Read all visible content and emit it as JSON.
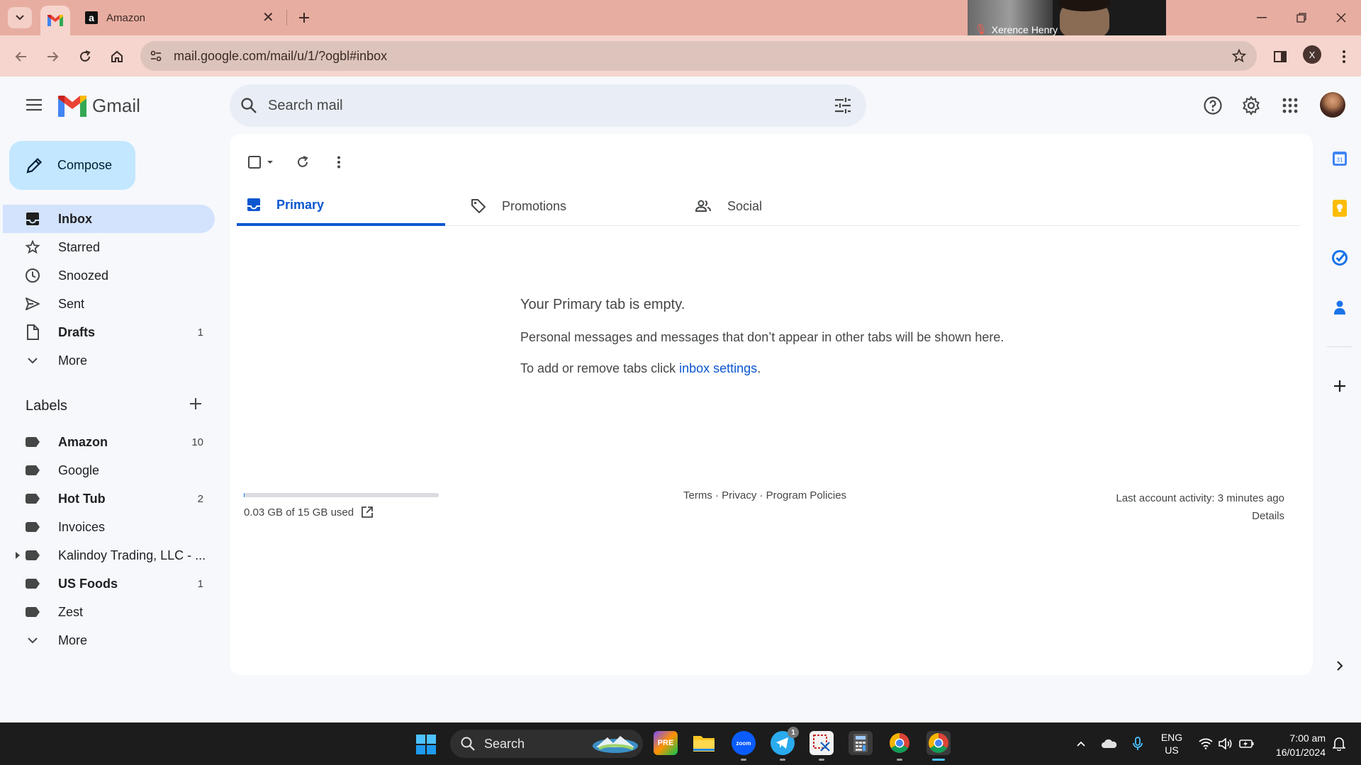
{
  "browser": {
    "tabs": [
      {
        "label": ""
      },
      {
        "label": "Amazon"
      }
    ],
    "url": "mail.google.com/mail/u/1/?ogbl#inbox",
    "profile_initial": "X",
    "call_overlay_name": "Xerence Henry"
  },
  "gmail": {
    "logo_text": "Gmail",
    "search_placeholder": "Search mail",
    "compose_label": "Compose",
    "nav": [
      {
        "label": "Inbox",
        "count": ""
      },
      {
        "label": "Starred",
        "count": ""
      },
      {
        "label": "Snoozed",
        "count": ""
      },
      {
        "label": "Sent",
        "count": ""
      },
      {
        "label": "Drafts",
        "count": "1"
      },
      {
        "label": "More",
        "count": ""
      }
    ],
    "labels_heading": "Labels",
    "labels": [
      {
        "label": "Amazon",
        "count": "10"
      },
      {
        "label": "Google",
        "count": ""
      },
      {
        "label": "Hot Tub",
        "count": "2"
      },
      {
        "label": "Invoices",
        "count": ""
      },
      {
        "label": "Kalindoy Trading, LLC - ...",
        "count": ""
      },
      {
        "label": "US Foods",
        "count": "1"
      },
      {
        "label": "Zest",
        "count": ""
      },
      {
        "label": "More",
        "count": ""
      }
    ],
    "category_tabs": [
      {
        "label": "Primary"
      },
      {
        "label": "Promotions"
      },
      {
        "label": "Social"
      }
    ],
    "empty_state": {
      "title": "Your Primary tab is empty.",
      "subtitle": "Personal messages and messages that don’t appear in other tabs will be shown here.",
      "tip_prefix": "To add or remove tabs click ",
      "tip_link": "inbox settings",
      "tip_suffix": "."
    },
    "footer": {
      "storage_used_fraction": 0.002,
      "storage_text": "0.03 GB of 15 GB used",
      "links": "Terms · Privacy · Program Policies",
      "activity": "Last account activity: 3 minutes ago",
      "details": "Details"
    }
  },
  "taskbar": {
    "search_label": "Search",
    "telegram_badge": "1",
    "language": "ENG",
    "region": "US",
    "time": "7:00 am",
    "date": "16/01/2024"
  },
  "colors": {
    "titlebar": "#e8ada1",
    "toolbar": "#f5d5cd",
    "compose": "#c2e7ff",
    "active_nav": "#d3e3fd",
    "accent": "#0b57d0"
  }
}
